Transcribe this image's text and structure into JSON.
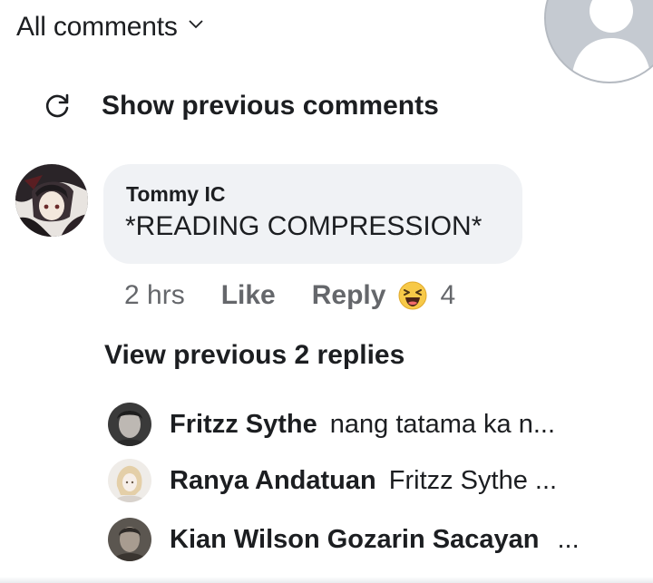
{
  "header": {
    "title": "All comments",
    "dropdown_icon": "chevron-down-icon"
  },
  "show_previous": {
    "label": "Show previous comments",
    "icon": "refresh-icon"
  },
  "comment": {
    "author": "Tommy IC",
    "text": "*READING COMPRESSION*",
    "time": "2 hrs",
    "like_label": "Like",
    "reply_label": "Reply",
    "reaction_icon": "haha-reaction-icon",
    "reaction_count": "4"
  },
  "view_previous_replies": "View previous 2 replies",
  "replies": [
    {
      "name": "Fritzz Sythe",
      "text": "nang tatama ka n..."
    },
    {
      "name": "Ranya Andatuan",
      "text": "Fritzz Sythe ..."
    },
    {
      "name": "Kian Wilson Gozarin Sacayan",
      "text": "..."
    }
  ],
  "colors": {
    "bubble_background": "#f0f2f5",
    "primary_text": "#1c1e21",
    "secondary_text": "#65676b"
  }
}
